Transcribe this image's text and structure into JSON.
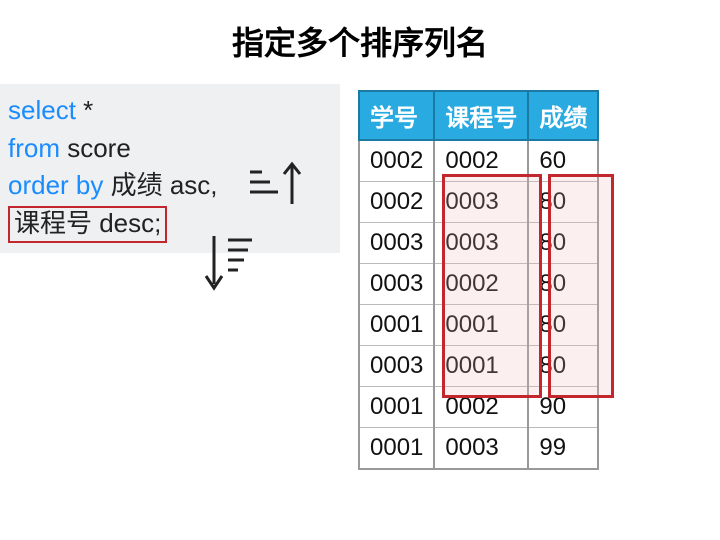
{
  "title": "指定多个排序列名",
  "sql": {
    "kw_select": "select",
    "star": " *",
    "kw_from": "from",
    "tbl": " score",
    "kw_orderby": "order by",
    "ordercol1": " 成绩 asc,",
    "ordercol2": "课程号 desc;"
  },
  "table": {
    "headers": [
      "学号",
      "课程号",
      "成绩"
    ],
    "rows": [
      [
        "0002",
        "0002",
        "60"
      ],
      [
        "0002",
        "0003",
        "80"
      ],
      [
        "0003",
        "0003",
        "80"
      ],
      [
        "0003",
        "0002",
        "80"
      ],
      [
        "0001",
        "0001",
        "80"
      ],
      [
        "0003",
        "0001",
        "80"
      ],
      [
        "0001",
        "0002",
        "90"
      ],
      [
        "0001",
        "0003",
        "99"
      ]
    ]
  },
  "chart_data": {
    "type": "table",
    "title": "指定多个排序列名",
    "columns": [
      "学号",
      "课程号",
      "成绩"
    ],
    "rows": [
      [
        "0002",
        "0002",
        60
      ],
      [
        "0002",
        "0003",
        80
      ],
      [
        "0003",
        "0003",
        80
      ],
      [
        "0003",
        "0002",
        80
      ],
      [
        "0001",
        "0001",
        80
      ],
      [
        "0003",
        "0001",
        80
      ],
      [
        "0001",
        "0002",
        90
      ],
      [
        "0001",
        "0003",
        99
      ]
    ],
    "highlighted_rows_col2": [
      1,
      2,
      3,
      4,
      5
    ],
    "highlighted_rows_col3": [
      1,
      2,
      3,
      4,
      5
    ]
  }
}
